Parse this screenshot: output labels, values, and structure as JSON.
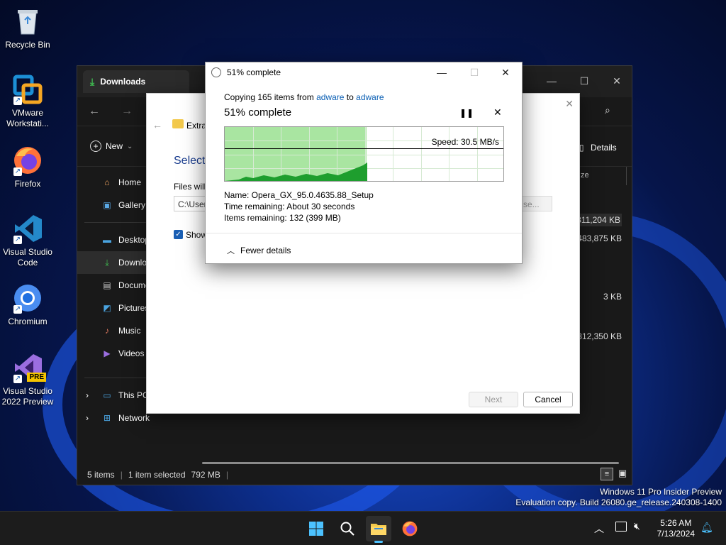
{
  "desktop": {
    "icons": [
      {
        "label": "Recycle Bin"
      },
      {
        "label": "VMware Workstati..."
      },
      {
        "label": "Firefox"
      },
      {
        "label": "Visual Studio Code"
      },
      {
        "label": "Chromium"
      },
      {
        "label": "Visual Studio 2022 Preview"
      }
    ],
    "vs_pre_badge": "PRE",
    "watermark_line1": "Windows 11 Pro Insider Preview",
    "watermark_line2": "Evaluation copy. Build 26080.ge_release.240308-1400"
  },
  "explorer": {
    "tab_title": "Downloads",
    "new_label": "New",
    "details_label": "Details",
    "size_header": "ze",
    "nav": [
      {
        "label": "Home"
      },
      {
        "label": "Gallery"
      },
      {
        "label": "Desktop"
      },
      {
        "label": "Downlo"
      },
      {
        "label": "Docume"
      },
      {
        "label": "Pictures"
      },
      {
        "label": "Music"
      },
      {
        "label": "Videos"
      },
      {
        "label": "This PC"
      },
      {
        "label": "Network"
      }
    ],
    "sizes": [
      "811,204 KB",
      "483,875 KB",
      "3 KB",
      "812,350 KB"
    ],
    "status_items": "5 items",
    "status_selected": "1 item selected",
    "status_size": "792 MB"
  },
  "wizard": {
    "breadcrumb": "Extra",
    "heading": "Select",
    "files_label": "Files will",
    "path_value": "C:\\User",
    "browse_label": "se...",
    "show_label": "Show",
    "next_label": "Next",
    "cancel_label": "Cancel"
  },
  "progress": {
    "title": "51% complete",
    "copying_prefix": "Copying 165 items from",
    "source": "adware",
    "to_word": "to",
    "dest": "adware",
    "heading": "51% complete",
    "percent": 51,
    "speed": "Speed: 30.5 MB/s",
    "name_line": "Name:  Opera_GX_95.0.4635.88_Setup",
    "time_line": "Time remaining:  About 30 seconds",
    "items_line": "Items remaining:  132 (399 MB)",
    "fewer_details": "Fewer details"
  },
  "taskbar": {
    "time": "5:26 AM",
    "date": "7/13/2024"
  }
}
